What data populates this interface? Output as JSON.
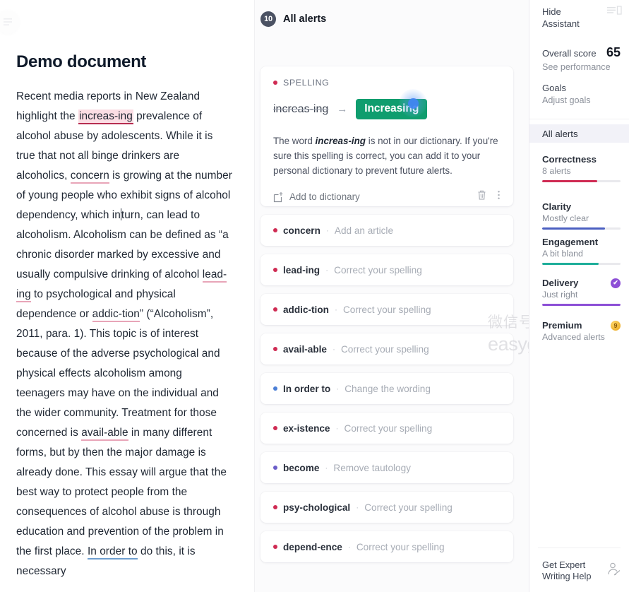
{
  "document": {
    "title": "Demo document",
    "paragraph_segments": [
      {
        "t": "Recent media reports in New Zealand highlight the ",
        "k": "plain"
      },
      {
        "t": "increas-ing",
        "k": "spell-hl"
      },
      {
        "t": " prevalence of alcohol abuse by adolescents. While it is true that not all binge drinkers are alcoholics, ",
        "k": "plain"
      },
      {
        "t": "concern",
        "k": "soft"
      },
      {
        "t": " is growing at the number of young people who exhibit signs of alcohol dependency, which in",
        "k": "plain"
      },
      {
        "t": "",
        "k": "caret"
      },
      {
        "t": "turn, can lead to alcoholism. Alcoholism can be defined as “a chronic disorder marked by excessive and usually compulsive drinking of alcohol ",
        "k": "plain"
      },
      {
        "t": "lead-ing",
        "k": "soft"
      },
      {
        "t": " to psychological and physical dependence or ",
        "k": "plain"
      },
      {
        "t": "addic-tion",
        "k": "soft"
      },
      {
        "t": "” (“Alcoholism”, 2011, para. 1). This topic is of interest because of the adverse psychological and physical effects alcoholism among teenagers may have on the individual and the wider community. Treatment for those concerned is ",
        "k": "plain"
      },
      {
        "t": "avail-able",
        "k": "soft"
      },
      {
        "t": " in many different forms, but by then the major damage is already done. This essay will argue that the best way to protect people from the consequences of alcohol abuse is through education and prevention of the problem in the first place. ",
        "k": "plain"
      },
      {
        "t": "In order to",
        "k": "blue"
      },
      {
        "t": " do this, it is necessary",
        "k": "plain"
      }
    ]
  },
  "alerts_panel": {
    "count_badge": "10",
    "header_label": "All alerts",
    "expanded_card": {
      "category": "SPELLING",
      "original_word": "increas-ing",
      "arrow": "→",
      "suggestion": "Increasing",
      "explanation_prefix": "The word ",
      "explanation_word": "increas-ing",
      "explanation_suffix": " is not in our dictionary. If you're sure this spelling is correct, you can add it to your personal dictionary to prevent future alerts.",
      "add_to_dictionary_label": "Add to dictionary",
      "trash_icon": "trash-icon",
      "more_icon": "more-options-icon"
    },
    "collapsed_cards": [
      {
        "word": "concern",
        "action": "Add an article",
        "dot": "red"
      },
      {
        "word": "lead-ing",
        "action": "Correct your spelling",
        "dot": "red"
      },
      {
        "word": "addic-tion",
        "action": "Correct your spelling",
        "dot": "red"
      },
      {
        "word": "avail-able",
        "action": "Correct your spelling",
        "dot": "red"
      },
      {
        "word": "In order to",
        "action": "Change the wording",
        "dot": "blue"
      },
      {
        "word": "ex-istence",
        "action": "Correct your spelling",
        "dot": "red"
      },
      {
        "word": "become",
        "action": "Remove tautology",
        "dot": "purple"
      },
      {
        "word": "psy-chological",
        "action": "Correct your spelling",
        "dot": "red"
      },
      {
        "word": "depend-ence",
        "action": "Correct your spelling",
        "dot": "red"
      }
    ]
  },
  "sidebar": {
    "hide_assistant": "Hide\nAssistant",
    "hide_assistant_line1": "Hide",
    "hide_assistant_line2": "Assistant",
    "panel_icon": "panel-toggle-icon",
    "overall_score_label": "Overall score",
    "overall_score_value": "65",
    "see_performance": "See performance",
    "goals_label": "Goals",
    "adjust_goals": "Adjust goals",
    "all_alerts": "All alerts",
    "categories": [
      {
        "name": "Correctness",
        "sub": "8 alerts",
        "bar_pct": 70,
        "color": "#cf2b53",
        "badge": null
      },
      {
        "name": "Clarity",
        "sub": "Mostly clear",
        "bar_pct": 80,
        "color": "#4b5fc1",
        "badge": null
      },
      {
        "name": "Engagement",
        "sub": "A bit bland",
        "bar_pct": 72,
        "color": "#1eae9a",
        "badge": null
      },
      {
        "name": "Delivery",
        "sub": "Just right",
        "bar_pct": 100,
        "color": "#8d4fd6",
        "badge": "check"
      },
      {
        "name": "Premium",
        "sub": "Advanced alerts",
        "bar_pct": 0,
        "color": "#e8a317",
        "badge": "premium"
      }
    ],
    "badge_check_glyph": "✔",
    "badge_premium_glyph": "9",
    "expert_line1": "Get Expert",
    "expert_line2": "Writing Help",
    "expert_icon": "expert-writer-icon"
  },
  "watermark": {
    "cn": "微信号",
    "en": "easygpaschool"
  }
}
